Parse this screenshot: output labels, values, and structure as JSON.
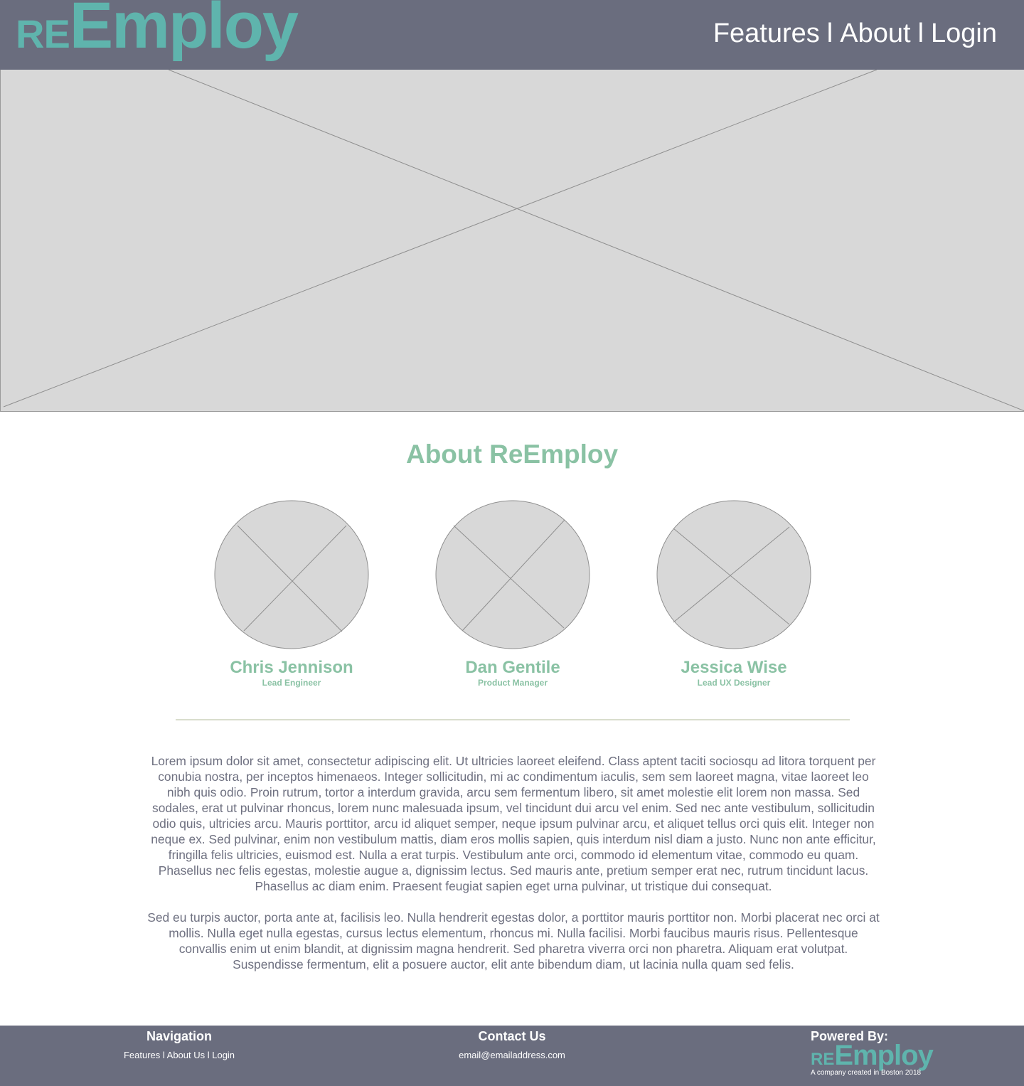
{
  "header": {
    "logo": {
      "prefix": "RE",
      "main": "Employ"
    },
    "nav": {
      "features": "Features",
      "about": "About",
      "login": "Login",
      "separator": "l"
    }
  },
  "hero": {
    "image": "placeholder-image"
  },
  "about": {
    "title": "About ReEmploy",
    "team": [
      {
        "name": "Chris Jennison",
        "role": "Lead Engineer"
      },
      {
        "name": "Dan Gentile",
        "role": "Product Manager"
      },
      {
        "name": "Jessica Wise",
        "role": "Lead UX Designer"
      }
    ],
    "paragraphs": [
      "Lorem ipsum dolor sit amet, consectetur adipiscing elit. Ut ultricies laoreet eleifend. Class aptent taciti sociosqu ad litora torquent per conubia nostra, per inceptos himenaeos. Integer sollicitudin, mi ac condimentum iaculis, sem sem laoreet magna, vitae laoreet leo nibh quis odio. Proin rutrum, tortor a interdum gravida, arcu sem fermentum libero, sit amet molestie elit lorem non massa. Sed sodales, erat ut pulvinar rhoncus, lorem nunc malesuada ipsum, vel tincidunt dui arcu vel enim. Sed nec ante vestibulum, sollicitudin odio quis, ultricies arcu. Mauris porttitor, arcu id aliquet semper, neque ipsum pulvinar arcu, et aliquet tellus orci quis elit. Integer non neque ex. Sed pulvinar, enim non vestibulum mattis, diam eros mollis sapien, quis interdum nisl diam a justo. Nunc non ante efficitur, fringilla felis ultricies, euismod est. Nulla a erat turpis. Vestibulum ante orci, commodo id elementum vitae, commodo eu quam. Phasellus nec felis egestas, molestie augue a, dignissim lectus. Sed mauris ante, pretium semper erat nec, rutrum tincidunt lacus. Phasellus ac diam enim. Praesent feugiat sapien eget urna pulvinar, ut tristique dui consequat.",
      "Sed eu turpis auctor, porta ante at, facilisis leo. Nulla hendrerit egestas dolor, a porttitor mauris porttitor non. Morbi placerat nec orci at mollis. Nulla eget nulla egestas, cursus lectus elementum, rhoncus mi. Nulla facilisi. Morbi faucibus mauris risus. Pellentesque convallis enim ut enim blandit, at dignissim magna hendrerit. Sed pharetra viverra orci non pharetra. Aliquam erat volutpat. Suspendisse fermentum, elit a posuere auctor, elit ante bibendum diam, ut lacinia nulla quam sed felis."
    ]
  },
  "footer": {
    "navigation": {
      "heading": "Navigation",
      "links": "Features l About Us l Login"
    },
    "contact": {
      "heading": "Contact Us",
      "email": "email@emailaddress.com"
    },
    "powered": {
      "heading": "Powered By:",
      "logo_prefix": "RE",
      "logo_main": "Employ",
      "tagline": "A company created in Boston 2018"
    }
  },
  "colors": {
    "header_bg": "#6a6d7e",
    "logo": "#5fb4ad",
    "accent": "#8ac2a4",
    "placeholder": "#d8d8d8",
    "body_text": "#6e7080"
  }
}
